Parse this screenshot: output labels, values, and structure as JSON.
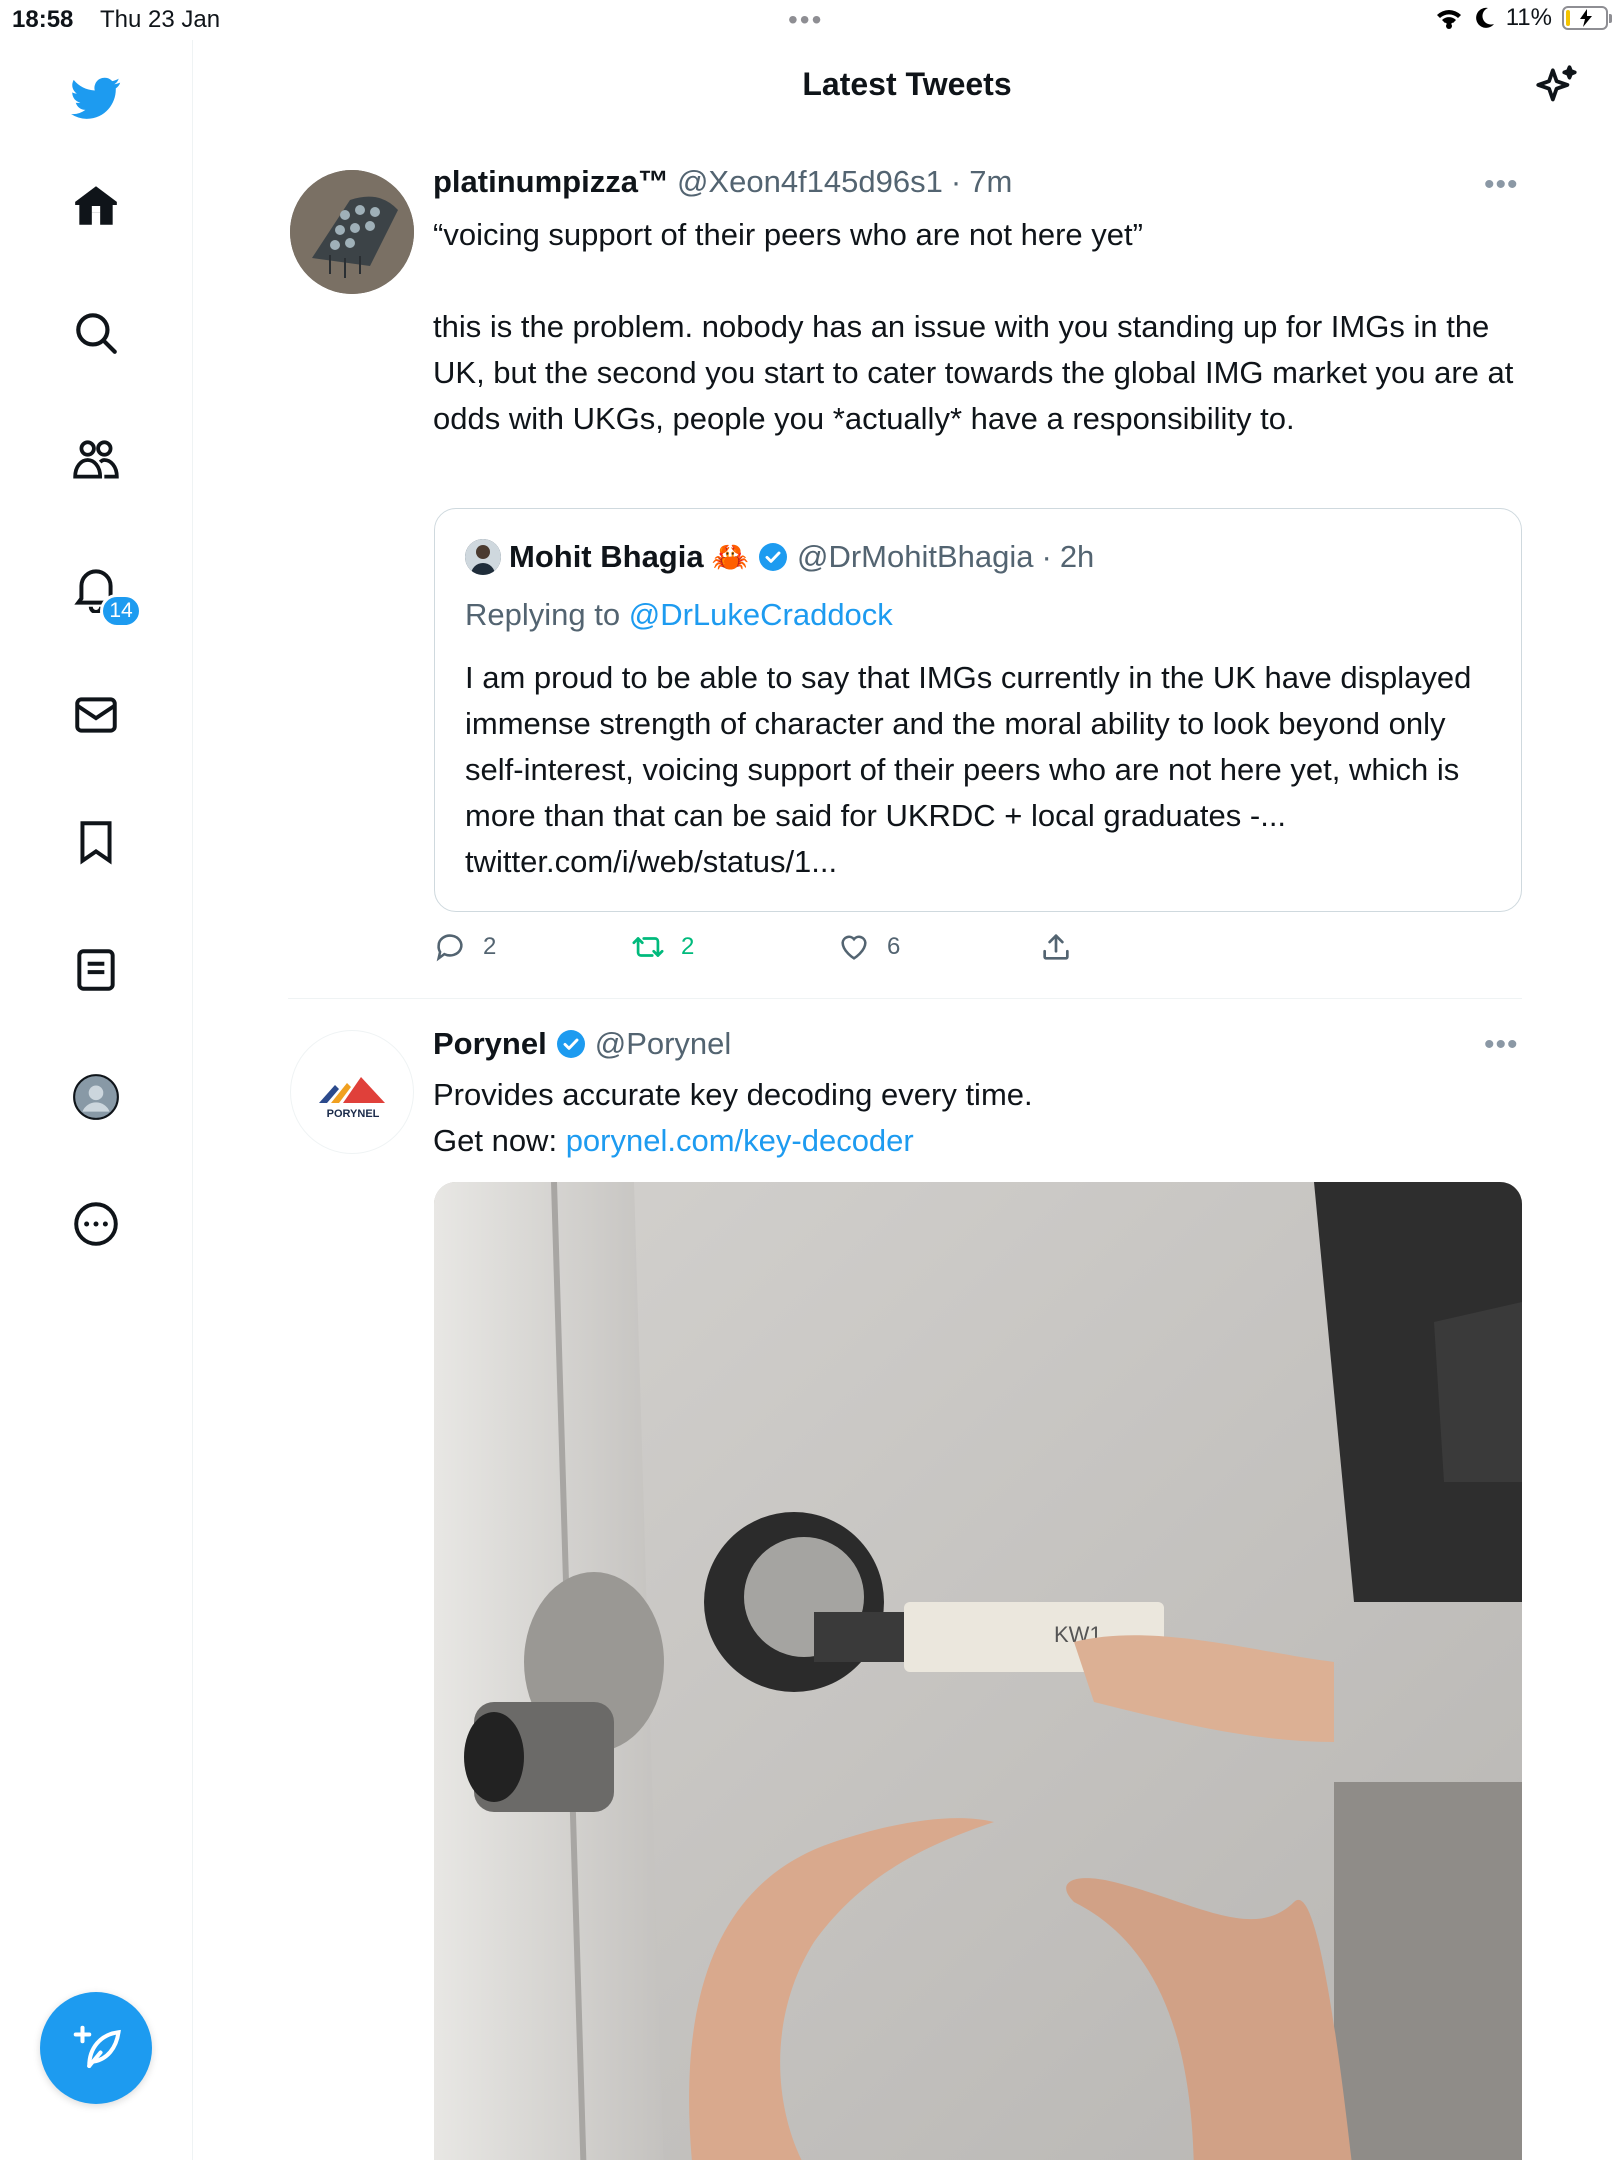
{
  "status_bar": {
    "time": "18:58",
    "date": "Thu 23 Jan",
    "battery": "11%",
    "battery_level": 0.11
  },
  "sidebar": {
    "items": [
      {
        "name": "home",
        "icon": "home-icon"
      },
      {
        "name": "search",
        "icon": "search-icon"
      },
      {
        "name": "communities",
        "icon": "people-icon"
      },
      {
        "name": "notifications",
        "icon": "bell-icon"
      },
      {
        "name": "messages",
        "icon": "envelope-icon"
      },
      {
        "name": "bookmarks",
        "icon": "bookmark-icon"
      },
      {
        "name": "lists",
        "icon": "list-icon"
      },
      {
        "name": "profile",
        "icon": "avatar-icon"
      },
      {
        "name": "more",
        "icon": "more-circle-icon"
      }
    ],
    "notification_count": "14",
    "compose_icon": "compose-icon"
  },
  "header": {
    "title": "Latest Tweets",
    "sparkle_icon": "sparkle-icon"
  },
  "tweets": [
    {
      "display_name": "platinumpizza™",
      "handle": "@Xeon4f145d96s1",
      "separator": "·",
      "time": "7m",
      "text_line1": "“voicing support of their peers who are not here yet”",
      "text_paragraph2": "this is the problem. nobody has an issue with you standing up for IMGs in the UK, but the second you start to cater towards the global IMG market you are at odds with UKGs, people you *actually* have a responsibility to.",
      "quote": {
        "display_name": "Mohit Bhagia",
        "emoji": "🦀",
        "handle": "@DrMohitBhagia",
        "separator": "·",
        "time": "2h",
        "replying_prefix": "Replying to",
        "replying_to": "@DrLukeCraddock",
        "text": "I am proud to be able to say that IMGs currently in the UK have displayed immense strength of character and the moral ability to look beyond only self-interest, voicing support of their peers who are not here yet, which is more than that can be said for UKRDC + local graduates -... twitter.com/i/web/status/1..."
      },
      "replies": "2",
      "retweets": "2",
      "likes": "6"
    },
    {
      "display_name": "Porynel",
      "handle": "@Porynel",
      "text_line1": "Provides accurate key decoding every time.",
      "get_now_label": "Get now:",
      "link": "porynel.com/key-decoder",
      "avatar_logo_text": "PORYNEL"
    }
  ],
  "colors": {
    "accent": "#1d9bf0",
    "retweet": "#00ba7c",
    "secondary_text": "#536471"
  }
}
